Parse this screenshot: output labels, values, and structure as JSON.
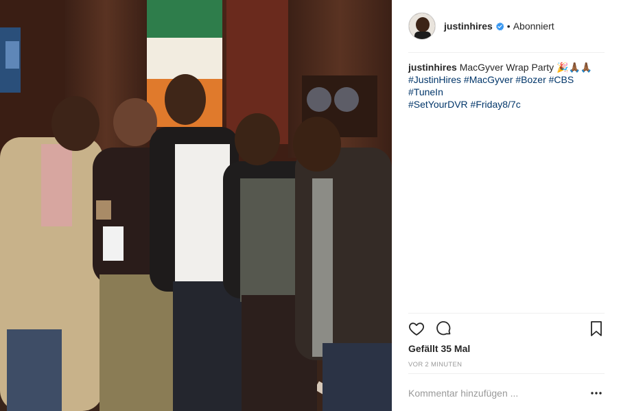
{
  "post": {
    "photo_alt": "Five men posing together at a wrap party",
    "author": {
      "username": "justinhires",
      "verified": true,
      "follow_status": "Abonniert",
      "separator": "•"
    },
    "caption": {
      "username": "justinhires",
      "text": "MacGyver Wrap Party",
      "emoji": "🎉🙏🏾🙏🏾",
      "hashtags": [
        "#JustinHires",
        "#MacGyver",
        "#Bozer",
        "#CBS",
        "#TuneIn",
        "#SetYourDVR",
        "#Friday8/7c"
      ]
    },
    "likes_text": "Gefällt 35 Mal",
    "timestamp": "VOR 2 MINUTEN",
    "comment_placeholder": "Kommentar hinzufügen ...",
    "icons": {
      "like": "heart-icon",
      "comment": "comment-icon",
      "save": "bookmark-icon",
      "more": "more-options-icon",
      "verified": "verified-badge-icon"
    },
    "colors": {
      "text": "#262626",
      "hashtag": "#003569",
      "muted": "#999999",
      "verified": "#3897f0",
      "divider": "#efefef"
    }
  }
}
